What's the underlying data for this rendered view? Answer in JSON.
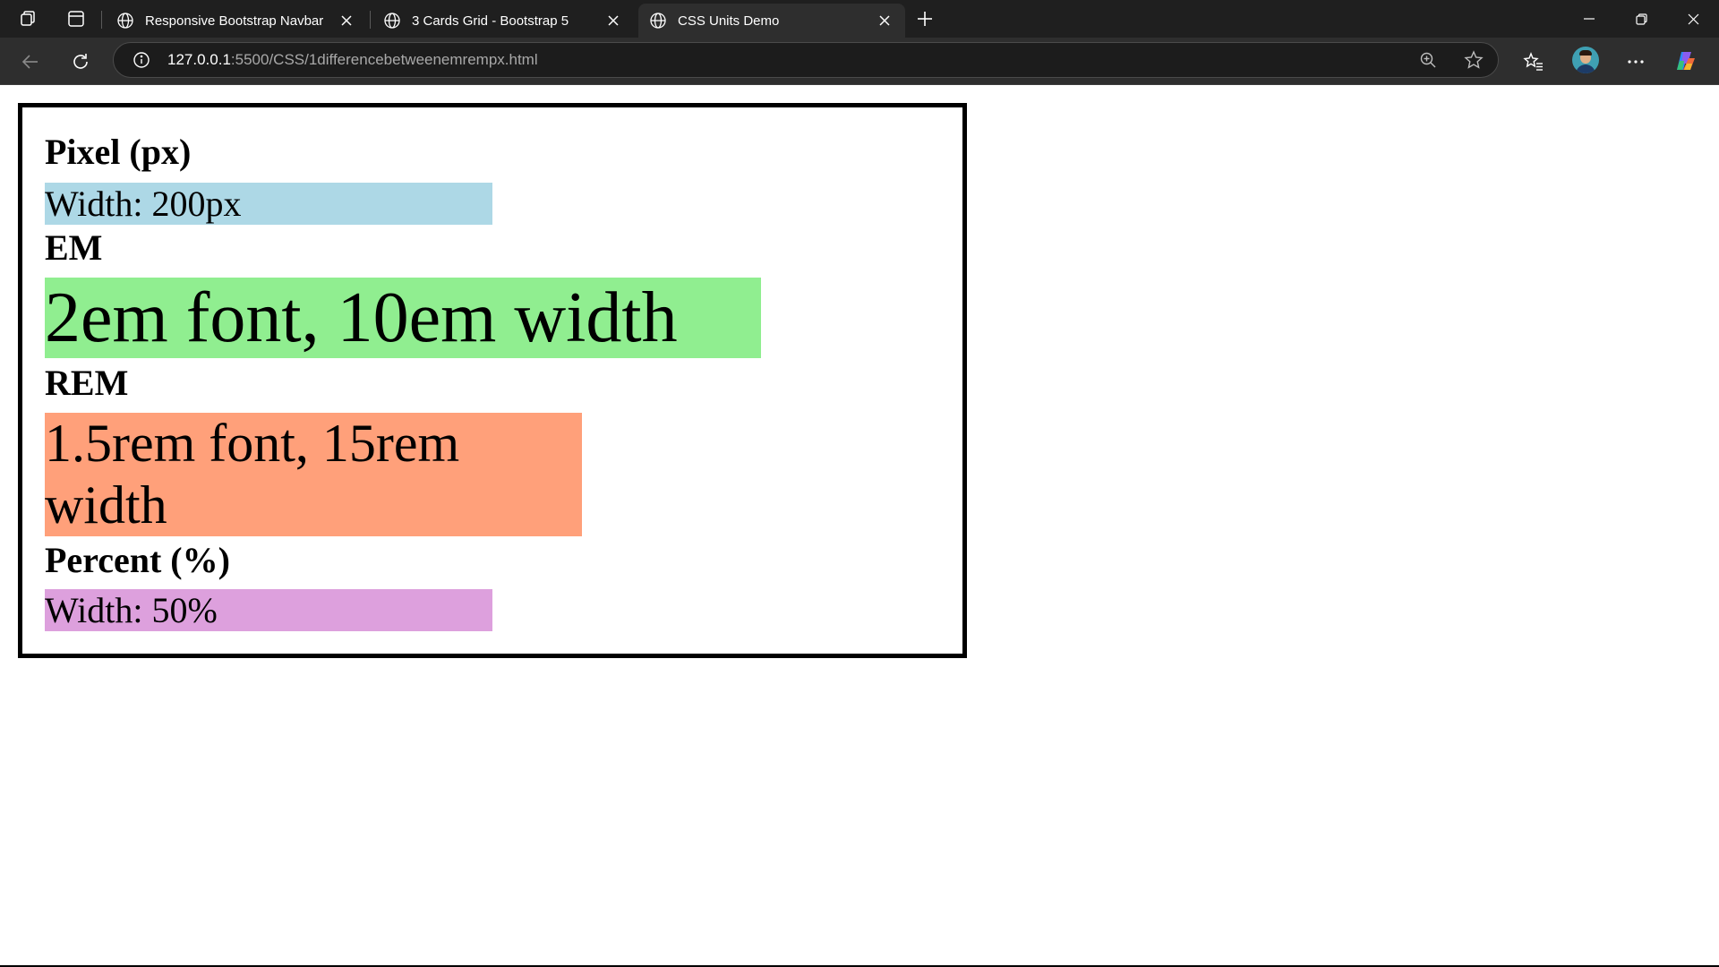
{
  "browser": {
    "tabs": [
      {
        "title": "Responsive Bootstrap Navbar",
        "active": false
      },
      {
        "title": "3 Cards Grid - Bootstrap 5",
        "active": false
      },
      {
        "title": "CSS Units Demo",
        "active": true
      }
    ],
    "address": {
      "host": "127.0.0.1",
      "path": ":5500/CSS/1differencebetweenemrempx.html"
    },
    "icons": {
      "workspaces": "workspaces-icon",
      "tab_actions": "vertical-tabs-icon",
      "tab_favicon": "globe-icon",
      "tab_close": "close-icon",
      "new_tab": "plus-icon",
      "back": "back-arrow-icon",
      "refresh": "refresh-icon",
      "site_info": "info-icon",
      "zoom": "zoom-icon",
      "favorite": "star-icon",
      "favorites": "favorites-icon",
      "profile": "avatar",
      "more": "ellipsis-icon",
      "copilot": "copilot-icon",
      "minimize": "minimize-icon",
      "restore": "restore-icon",
      "close_window": "close-icon"
    }
  },
  "page": {
    "sections": [
      {
        "heading": "Pixel (px)",
        "box_text": "Width: 200px",
        "box_color": "#add8e6"
      },
      {
        "heading": "EM",
        "box_text": "2em font, 10em width",
        "box_color": "#90ee90"
      },
      {
        "heading": "REM",
        "box_text": "1.5rem font, 15rem width",
        "box_color": "#ffa07a"
      },
      {
        "heading": "Percent (%)",
        "box_text": "Width: 50%",
        "box_color": "#dda0dd"
      }
    ],
    "border_color": "#000000"
  }
}
